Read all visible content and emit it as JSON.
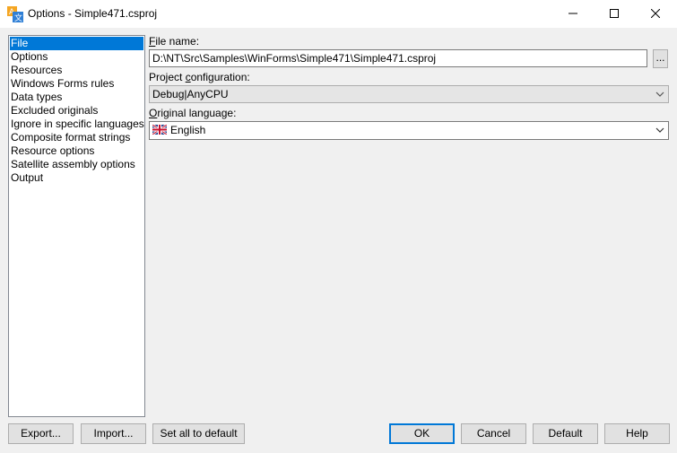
{
  "window": {
    "title": "Options - Simple471.csproj"
  },
  "nav": {
    "items": [
      "File",
      "Options",
      "Resources",
      "Windows Forms rules",
      "Data types",
      "Excluded originals",
      "Ignore in specific languages",
      "Composite format strings",
      "Resource options",
      "Satellite assembly options",
      "Output"
    ],
    "selected": 0
  },
  "file_name": {
    "label_first": "F",
    "label_rest": "ile name:",
    "value": "D:\\NT\\Src\\Samples\\WinForms\\Simple471\\Simple471.csproj",
    "browse_label": "..."
  },
  "project_config": {
    "label_before": "Project ",
    "label_ul": "c",
    "label_after": "onfiguration:",
    "value": "Debug|AnyCPU"
  },
  "original_language": {
    "label_first": "O",
    "label_rest": "riginal language:",
    "value": "English",
    "flag_icon": "uk-flag-icon"
  },
  "buttons": {
    "export": "Export...",
    "import": "Import...",
    "set_default": "Set all to default",
    "ok": "OK",
    "cancel": "Cancel",
    "default": "Default",
    "help": "Help"
  },
  "colors": {
    "accent": "#0078d7"
  }
}
